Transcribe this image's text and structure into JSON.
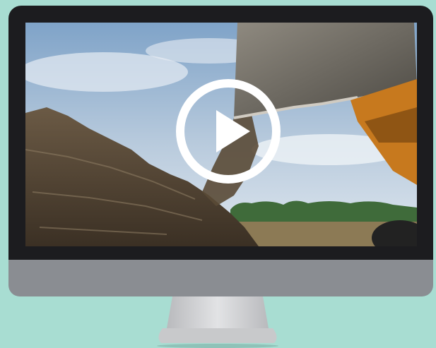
{
  "video": {
    "play_label": ""
  },
  "icons": {
    "play": "play-icon"
  },
  "colors": {
    "background": "#a8ddd2",
    "bezel": "#1c1c1f",
    "chin": "#8a8d92",
    "stand": "#c8c9cb",
    "play_ring": "#ffffff"
  }
}
